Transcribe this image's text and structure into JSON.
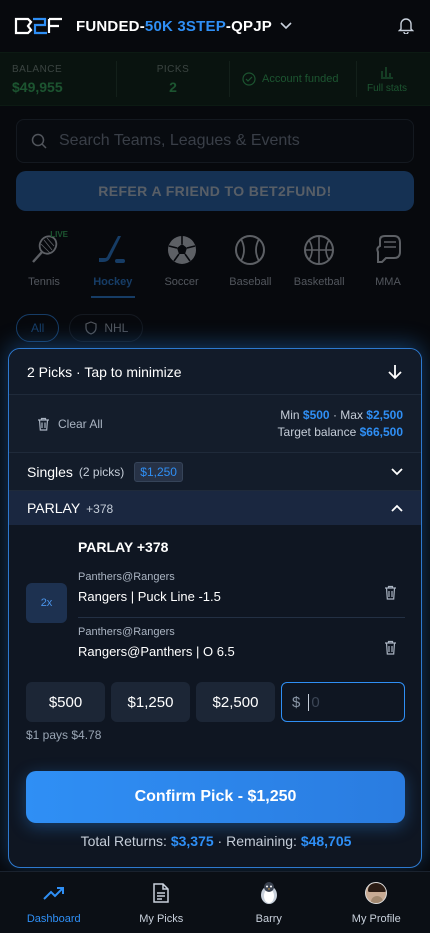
{
  "header": {
    "title_prefix": "FUNDED-",
    "title_highlight": "50K 3STEP",
    "title_suffix": "-QPJP"
  },
  "stats": {
    "balance_label": "BALANCE",
    "balance_value": "$49,955",
    "picks_label": "PICKS",
    "picks_value": "2",
    "funded_text": "Account funded",
    "full_stats": "Full stats"
  },
  "search": {
    "placeholder": "Search Teams, Leagues & Events"
  },
  "refer": {
    "label": "REFER A FRIEND TO BET2FUND!"
  },
  "sports": [
    {
      "label": "Tennis",
      "icon": "tennis-icon",
      "badge": "LIVE"
    },
    {
      "label": "Hockey",
      "icon": "hockey-icon",
      "active": true
    },
    {
      "label": "Soccer",
      "icon": "soccer-icon"
    },
    {
      "label": "Baseball",
      "icon": "baseball-icon"
    },
    {
      "label": "Basketball",
      "icon": "basketball-icon"
    },
    {
      "label": "MMA",
      "icon": "mma-icon"
    }
  ],
  "chips": {
    "all": "All",
    "nhl": "NHL"
  },
  "slip": {
    "header": "2 Picks · Tap to minimize",
    "clear_all": "Clear All",
    "min_label": "Min",
    "min_value": "$500",
    "max_label": "· Max",
    "max_value": "$2,500",
    "target_label": "Target balance",
    "target_value": "$66,500",
    "singles_title": "Singles",
    "singles_count": "(2 picks)",
    "singles_amount": "$1,250",
    "parlay_label": "PARLAY",
    "parlay_odds": "+378",
    "parlay_title": "PARLAY +378",
    "multiplier": "2x",
    "legs": [
      {
        "match": "Panthers@Rangers",
        "pick": "Rangers | Puck Line -1.5"
      },
      {
        "match": "Panthers@Rangers",
        "pick": "Rangers@Panthers | O 6.5"
      }
    ],
    "stakes": [
      "$500",
      "$1,250",
      "$2,500"
    ],
    "currency": "$",
    "stake_placeholder": "0",
    "pays": "$1 pays $4.78",
    "confirm": "Confirm Pick - $1,250",
    "total_label": "Total Returns:",
    "total_value": "$3,375",
    "remaining_label": "· Remaining:",
    "remaining_value": "$48,705"
  },
  "nav": {
    "dashboard": "Dashboard",
    "my_picks": "My Picks",
    "barry": "Barry",
    "my_profile": "My Profile"
  },
  "colors": {
    "accent": "#2f8ff5",
    "success": "#3fcf6a",
    "background": "#07090d"
  }
}
